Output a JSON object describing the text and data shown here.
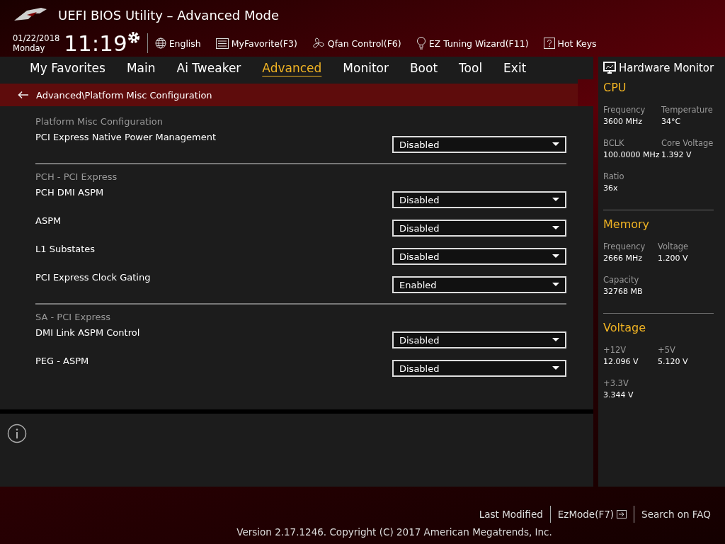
{
  "header": {
    "title": "UEFI BIOS Utility – Advanced Mode",
    "date": "01/22/2018",
    "day": "Monday",
    "time": "11:19",
    "tools": [
      {
        "kind": "globe",
        "label": "English"
      },
      {
        "kind": "favorite",
        "label": "MyFavorite(F3)"
      },
      {
        "kind": "fan",
        "label": "Qfan Control(F6)"
      },
      {
        "kind": "bulb",
        "label": "EZ Tuning Wizard(F11)"
      },
      {
        "kind": "help",
        "label": "Hot Keys"
      }
    ]
  },
  "tabs": [
    {
      "label": "My Favorites",
      "selected": false
    },
    {
      "label": "Main",
      "selected": false
    },
    {
      "label": "Ai Tweaker",
      "selected": false
    },
    {
      "label": "Advanced",
      "selected": true
    },
    {
      "label": "Monitor",
      "selected": false
    },
    {
      "label": "Boot",
      "selected": false
    },
    {
      "label": "Tool",
      "selected": false
    },
    {
      "label": "Exit",
      "selected": false
    }
  ],
  "breadcrumb": "Advanced\\Platform Misc Configuration",
  "sections": [
    {
      "title": "Platform Misc Configuration",
      "settings": [
        {
          "label": "PCI Express Native Power Management",
          "value": "Disabled"
        }
      ]
    },
    {
      "title": "PCH - PCI Express",
      "settings": [
        {
          "label": "PCH DMI ASPM",
          "value": "Disabled"
        },
        {
          "label": "ASPM",
          "value": "Disabled"
        },
        {
          "label": "L1 Substates",
          "value": "Disabled"
        },
        {
          "label": "PCI Express Clock Gating",
          "value": "Enabled"
        }
      ]
    },
    {
      "title": "SA - PCI Express",
      "settings": [
        {
          "label": "DMI Link ASPM Control",
          "value": "Disabled"
        },
        {
          "label": "PEG - ASPM",
          "value": "Disabled"
        }
      ]
    }
  ],
  "hardware_monitor": {
    "title": "Hardware Monitor",
    "groups": [
      {
        "title": "CPU",
        "rows": [
          [
            {
              "label": "Frequency",
              "value": "3600 MHz"
            },
            {
              "label": "Temperature",
              "value": "34°C"
            }
          ],
          [
            {
              "label": "BCLK",
              "value": "100.0000 MHz"
            },
            {
              "label": "Core Voltage",
              "value": "1.392 V"
            }
          ],
          [
            {
              "label": "Ratio",
              "value": "36x"
            }
          ]
        ]
      },
      {
        "title": "Memory",
        "rows": [
          [
            {
              "label": "Frequency",
              "value": "2666 MHz"
            },
            {
              "label": "Voltage",
              "value": "1.200 V"
            }
          ],
          [
            {
              "label": "Capacity",
              "value": "32768 MB"
            }
          ]
        ]
      },
      {
        "title": "Voltage",
        "rows": [
          [
            {
              "label": "+12V",
              "value": "12.096 V"
            },
            {
              "label": "+5V",
              "value": "5.120 V"
            }
          ],
          [
            {
              "label": "+3.3V",
              "value": "3.344 V"
            }
          ]
        ]
      }
    ]
  },
  "footer": {
    "links": [
      {
        "kind": "text",
        "label": "Last Modified"
      },
      {
        "kind": "ezmode",
        "label": "EzMode(F7)"
      },
      {
        "kind": "text",
        "label": "Search on FAQ"
      }
    ],
    "copyright": "Version 2.17.1246. Copyright (C) 2017 American Megatrends, Inc."
  }
}
